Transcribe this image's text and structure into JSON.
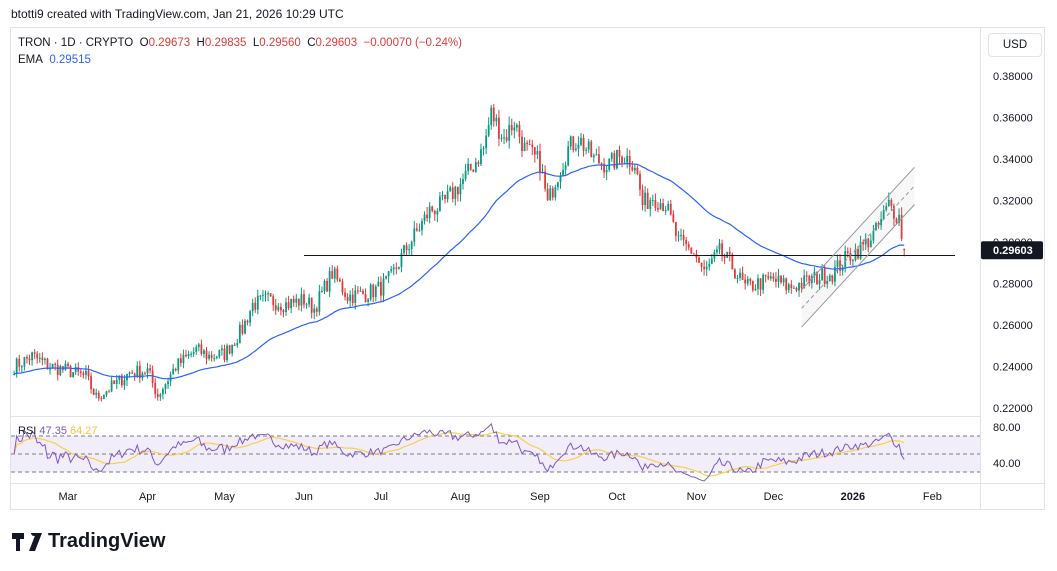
{
  "credit": "btotti9 created with TradingView.com, Jan 21, 2026 10:29 UTC",
  "legend": {
    "symbol": "TRON · 1D · CRYPTO",
    "o_label": "O",
    "o": "0.29673",
    "h_label": "H",
    "h": "0.29835",
    "l_label": "L",
    "l": "0.29560",
    "c_label": "C",
    "c": "0.29603",
    "change": "−0.00070 (−0.24%)",
    "ema_label": "EMA",
    "ema": "0.29515"
  },
  "currency_button": "USD",
  "rsi": {
    "label": "RSI",
    "value": "47.35",
    "ma_value": "64.27",
    "ticks": [
      "80.00",
      "40.00"
    ],
    "levels": [
      70,
      50,
      30
    ]
  },
  "logo": "TradingView",
  "colors": {
    "up": "#089981",
    "down": "#e03a3a",
    "ema": "#2962ff",
    "rsi": "#7e57c2",
    "rsi_ma": "#f7d04b",
    "last_price_bg": "#131722"
  },
  "chart_data": {
    "type": "candlestick",
    "symbol": "TRON",
    "interval": "1D",
    "ylim": [
      0.215,
      0.39
    ],
    "y_ticks": [
      "0.38000",
      "0.36000",
      "0.34000",
      "0.32000",
      "0.30000",
      "0.28000",
      "0.26000",
      "0.24000",
      "0.22000"
    ],
    "x_ticks": [
      "Mar",
      "Apr",
      "May",
      "Jun",
      "Jul",
      "Aug",
      "Sep",
      "Oct",
      "Nov",
      "Dec",
      "2026",
      "Feb"
    ],
    "last_price": "0.29603",
    "close_path": [
      [
        "2025-02-08",
        0.24
      ],
      [
        "2025-02-15",
        0.245
      ],
      [
        "2025-02-22",
        0.24
      ],
      [
        "2025-03-01",
        0.238
      ],
      [
        "2025-03-08",
        0.235
      ],
      [
        "2025-03-12",
        0.225
      ],
      [
        "2025-03-20",
        0.232
      ],
      [
        "2025-03-25",
        0.237
      ],
      [
        "2025-04-01",
        0.238
      ],
      [
        "2025-04-05",
        0.226
      ],
      [
        "2025-04-12",
        0.24
      ],
      [
        "2025-04-20",
        0.248
      ],
      [
        "2025-04-25",
        0.245
      ],
      [
        "2025-05-01",
        0.246
      ],
      [
        "2025-05-08",
        0.258
      ],
      [
        "2025-05-12",
        0.27
      ],
      [
        "2025-05-18",
        0.272
      ],
      [
        "2025-05-25",
        0.27
      ],
      [
        "2025-06-01",
        0.272
      ],
      [
        "2025-06-05",
        0.268
      ],
      [
        "2025-06-12",
        0.285
      ],
      [
        "2025-06-18",
        0.274
      ],
      [
        "2025-06-25",
        0.275
      ],
      [
        "2025-07-01",
        0.278
      ],
      [
        "2025-07-05",
        0.283
      ],
      [
        "2025-07-10",
        0.295
      ],
      [
        "2025-07-15",
        0.305
      ],
      [
        "2025-07-20",
        0.315
      ],
      [
        "2025-07-25",
        0.318
      ],
      [
        "2025-08-01",
        0.328
      ],
      [
        "2025-08-05",
        0.335
      ],
      [
        "2025-08-10",
        0.345
      ],
      [
        "2025-08-13",
        0.362
      ],
      [
        "2025-08-18",
        0.35
      ],
      [
        "2025-08-22",
        0.358
      ],
      [
        "2025-08-26",
        0.345
      ],
      [
        "2025-09-01",
        0.338
      ],
      [
        "2025-09-04",
        0.318
      ],
      [
        "2025-09-07",
        0.33
      ],
      [
        "2025-09-12",
        0.345
      ],
      [
        "2025-09-16",
        0.35
      ],
      [
        "2025-09-22",
        0.34
      ],
      [
        "2025-09-28",
        0.337
      ],
      [
        "2025-10-03",
        0.342
      ],
      [
        "2025-10-08",
        0.338
      ],
      [
        "2025-10-11",
        0.318
      ],
      [
        "2025-10-15",
        0.322
      ],
      [
        "2025-10-20",
        0.318
      ],
      [
        "2025-10-25",
        0.3
      ],
      [
        "2025-10-31",
        0.295
      ],
      [
        "2025-11-04",
        0.285
      ],
      [
        "2025-11-10",
        0.295
      ],
      [
        "2025-11-14",
        0.29
      ],
      [
        "2025-11-20",
        0.278
      ],
      [
        "2025-11-25",
        0.28
      ],
      [
        "2025-12-01",
        0.282
      ],
      [
        "2025-12-07",
        0.278
      ],
      [
        "2025-12-12",
        0.28
      ],
      [
        "2025-12-18",
        0.283
      ],
      [
        "2025-12-24",
        0.285
      ],
      [
        "2025-12-30",
        0.293
      ],
      [
        "2026-01-05",
        0.298
      ],
      [
        "2026-01-10",
        0.305
      ],
      [
        "2026-01-15",
        0.318
      ],
      [
        "2026-01-19",
        0.312
      ],
      [
        "2026-01-21",
        0.29603
      ]
    ],
    "drawings": {
      "horizontal_line": {
        "from": "2025-06-01",
        "to": "2026-02-08",
        "price": 0.2935
      },
      "channel": [
        {
          "from": [
            "2025-12-12",
            0.268
          ],
          "to": [
            "2026-01-25",
            0.327
          ]
        },
        {
          "from": [
            "2025-12-12",
            0.277
          ],
          "to": [
            "2026-01-25",
            0.336
          ]
        },
        {
          "from": [
            "2025-12-12",
            0.259
          ],
          "to": [
            "2026-01-25",
            0.318
          ]
        }
      ]
    }
  }
}
